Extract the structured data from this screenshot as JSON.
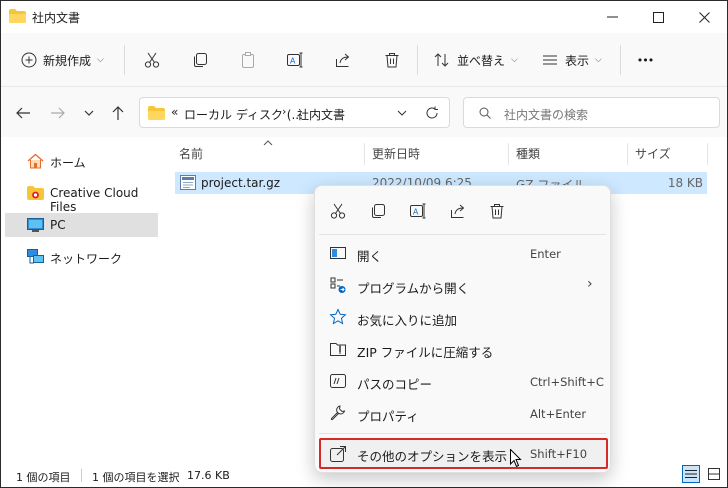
{
  "window": {
    "title": "社内文書"
  },
  "toolbar": {
    "new_label": "新規作成",
    "sort_label": "並べ替え",
    "view_label": "表示",
    "more_label": "•••"
  },
  "address": {
    "root_prefix": "«",
    "segment1": "ローカル ディスク (...",
    "segment2": "社内文書"
  },
  "search": {
    "placeholder": "社内文書の検索"
  },
  "sidebar": {
    "items": [
      {
        "label": "ホーム"
      },
      {
        "label": "Creative Cloud Files"
      },
      {
        "label": "PC"
      },
      {
        "label": "ネットワーク"
      }
    ]
  },
  "columns": {
    "name": "名前",
    "date": "更新日時",
    "type": "種類",
    "size": "サイズ"
  },
  "files": [
    {
      "name": "project.tar.gz",
      "date": "2022/10/09 6:25",
      "type": "GZ ファイル",
      "size": "18 KB"
    }
  ],
  "context_menu": {
    "items": [
      {
        "label": "開く",
        "shortcut": "Enter"
      },
      {
        "label": "プログラムから開く",
        "shortcut": "›"
      },
      {
        "label": "お気に入りに追加",
        "shortcut": ""
      },
      {
        "label": "ZIP ファイルに圧縮する",
        "shortcut": ""
      },
      {
        "label": "パスのコピー",
        "shortcut": "Ctrl+Shift+C"
      },
      {
        "label": "プロパティ",
        "shortcut": "Alt+Enter"
      },
      {
        "label": "その他のオプションを表示",
        "shortcut": "Shift+F10"
      }
    ]
  },
  "status": {
    "item_count": "1 個の項目",
    "selected": "1 個の項目を選択",
    "selected_size": "17.6 KB"
  },
  "colors": {
    "folder": "#f8c53a",
    "selection": "#cde8ff",
    "accent": "#0067c0",
    "highlight_border": "#d42a2a"
  }
}
